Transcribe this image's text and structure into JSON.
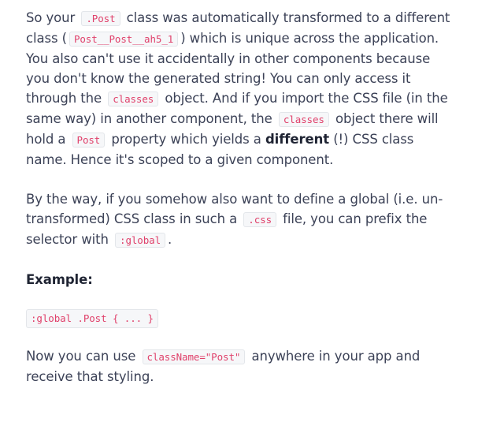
{
  "p1": {
    "t1": "So your",
    "c1": ".Post",
    "t2": "class was automatically transformed to a different class (",
    "c2": "Post__Post__ah5_1",
    "t3": ") which is unique across the application. You also can't use it accidentally in other components because you don't know the generated string! You can only access it through the",
    "c3": "classes",
    "t4": "object. And if you import the CSS file (in the same way) in another component, the",
    "c4": "classes",
    "t5": "object there will hold a",
    "c5": "Post",
    "t6": "property which yields a",
    "bold": "different",
    "t7": "(!) CSS class name. Hence it's scoped to a given component."
  },
  "p2": {
    "t1": "By the way, if you somehow also want to define a global (i.e. un-transformed) CSS class in such a",
    "c1": ".css",
    "t2": "file, you can prefix the selector with",
    "c2": ":global",
    "t3": "."
  },
  "example_heading": "Example:",
  "code_example": ":global .Post { ... }",
  "p3": {
    "t1": "Now you can use",
    "c1": "className=\"Post\"",
    "t2": "anywhere in your app and receive that styling."
  }
}
